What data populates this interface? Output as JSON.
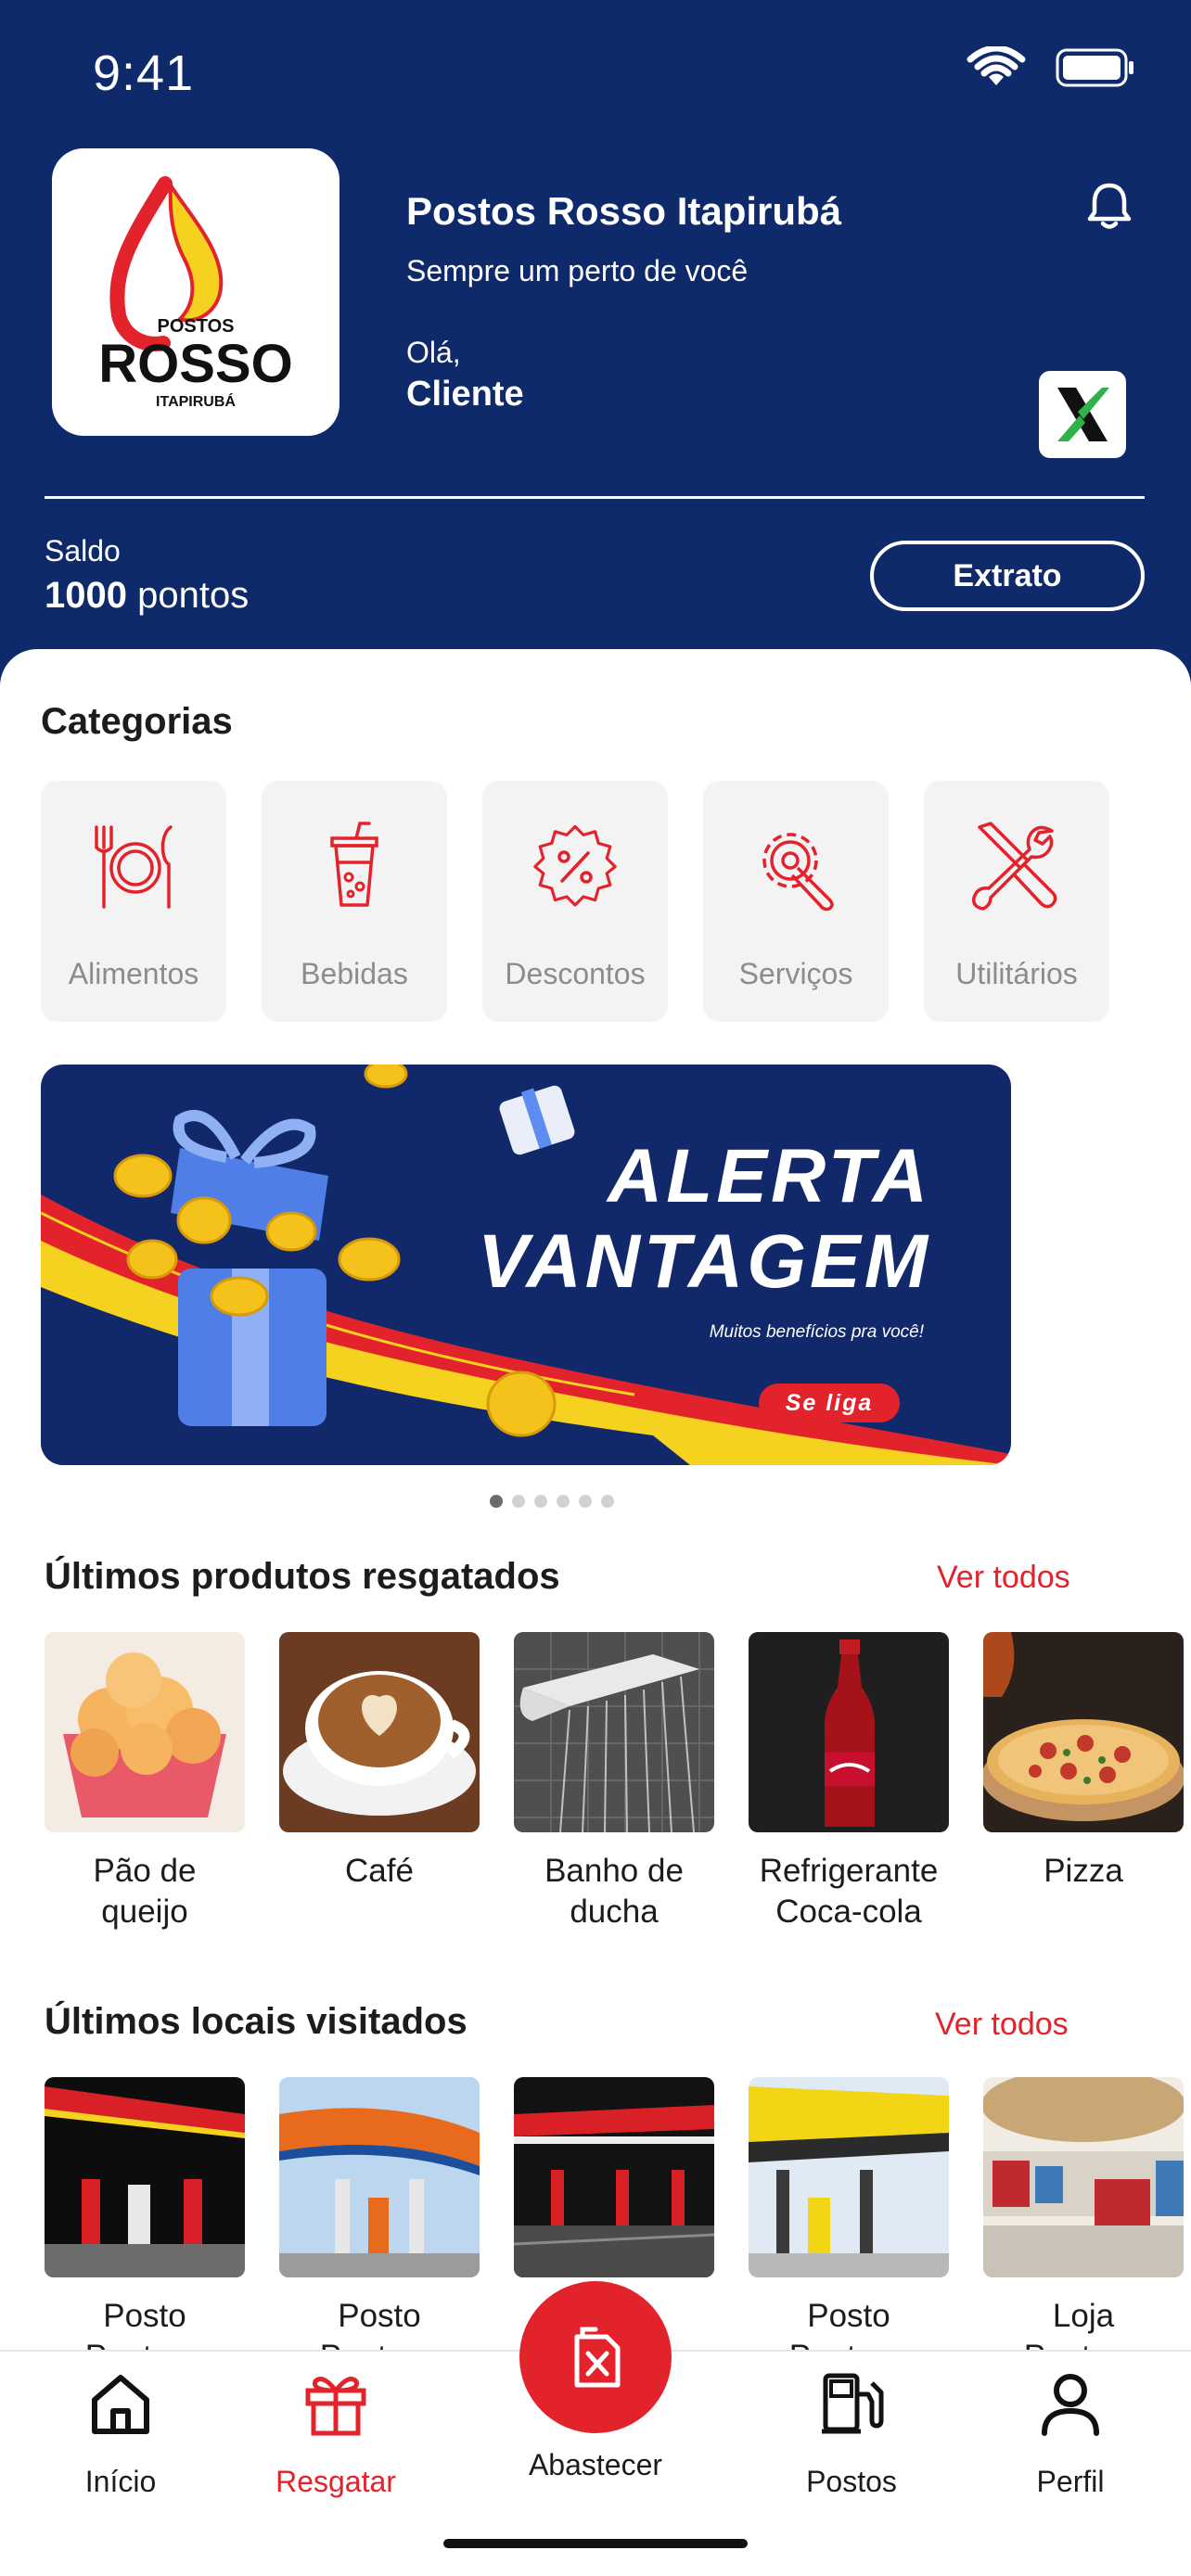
{
  "status_bar": {
    "time": "9:41"
  },
  "header": {
    "logo": {
      "line1": "POSTOS",
      "line2": "ROSSO",
      "line3": "ITAPIRUBÁ"
    },
    "brand_name": "Postos Rosso Itapirubá",
    "tagline": "Sempre um perto de você",
    "greeting": "Olá,",
    "user_name": "Cliente",
    "balance_label": "Saldo",
    "balance_points": "1000",
    "balance_unit": "pontos",
    "extrato_label": "Extrato"
  },
  "categories": {
    "title": "Categorias",
    "items": [
      {
        "label": "Alimentos",
        "icon": "plate-cutlery-icon"
      },
      {
        "label": "Bebidas",
        "icon": "drink-cup-icon"
      },
      {
        "label": "Descontos",
        "icon": "discount-badge-icon"
      },
      {
        "label": "Serviços",
        "icon": "gear-wrench-icon"
      },
      {
        "label": "Utilitários",
        "icon": "tools-icon"
      }
    ]
  },
  "banner": {
    "title_line1": "ALERTA",
    "title_line2": "VANTAGEM",
    "subtitle": "Muitos benefícios pra você!",
    "cta": "Se liga",
    "slide_count": 6,
    "active_slide": 1
  },
  "redeemed": {
    "title": "Últimos produtos resgatados",
    "see_all": "Ver todos",
    "items": [
      {
        "line1": "Pão de",
        "line2": "queijo"
      },
      {
        "line1": "Café",
        "line2": ""
      },
      {
        "line1": "Banho de",
        "line2": "ducha"
      },
      {
        "line1": "Refrigerante",
        "line2": "Coca-cola"
      },
      {
        "line1": "Pizza",
        "line2": ""
      }
    ]
  },
  "visited": {
    "title": "Últimos locais visitados",
    "see_all": "Ver todos",
    "items": [
      {
        "line1": "Posto",
        "line2": "Pontuax"
      },
      {
        "line1": "Posto",
        "line2": "Pontuax"
      },
      {
        "line1": "",
        "line2": ""
      },
      {
        "line1": "Posto",
        "line2": "Pontuax"
      },
      {
        "line1": "Loja",
        "line2": "Pontuax"
      }
    ]
  },
  "bottom_nav": {
    "items": [
      {
        "label": "Início",
        "icon": "home-icon"
      },
      {
        "label": "Resgatar",
        "icon": "gift-icon"
      },
      {
        "label": "Abastecer",
        "icon": "fuel-can-icon"
      },
      {
        "label": "Postos",
        "icon": "fuel-pump-icon"
      },
      {
        "label": "Perfil",
        "icon": "user-icon"
      }
    ]
  },
  "colors": {
    "brand_blue": "#0f2a6b",
    "accent_red": "#e3232b",
    "logo_yellow": "#f4d21f"
  }
}
